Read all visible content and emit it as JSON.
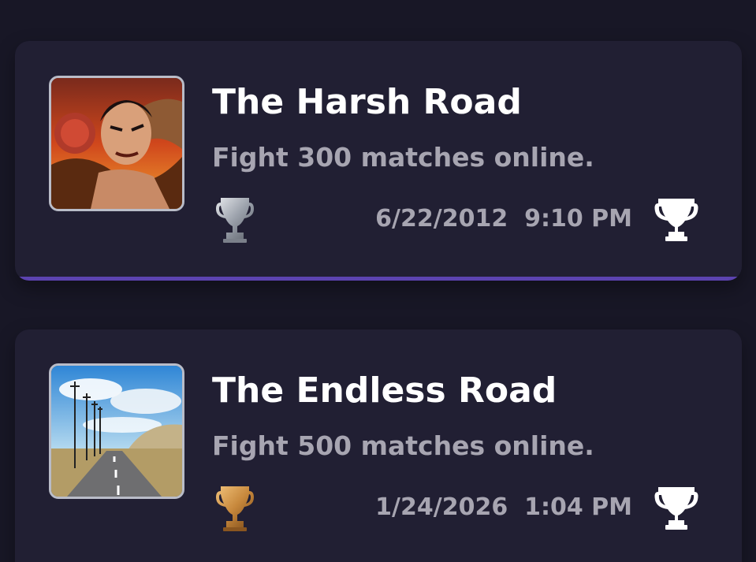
{
  "trophies": [
    {
      "title": "The Harsh Road",
      "description": "Fight 300 matches online.",
      "date": "6/22/2012",
      "time": "9:10 PM",
      "grade": "silver",
      "grade_icon": "silver-trophy-icon",
      "image": "fighter-portrait-image"
    },
    {
      "title": "The Endless Road",
      "description": "Fight 500 matches online.",
      "date": "1/24/2026",
      "time": "1:04 PM",
      "grade": "bronze",
      "grade_icon": "bronze-trophy-icon",
      "image": "road-landscape-image"
    }
  ],
  "colors": {
    "background": "#181726",
    "card": "#211f33",
    "accent": "#5c43b0",
    "title": "#ffffff",
    "subtext": "#a7a5b1",
    "silver": "#b8bcc4",
    "bronze": "#c7883c"
  }
}
